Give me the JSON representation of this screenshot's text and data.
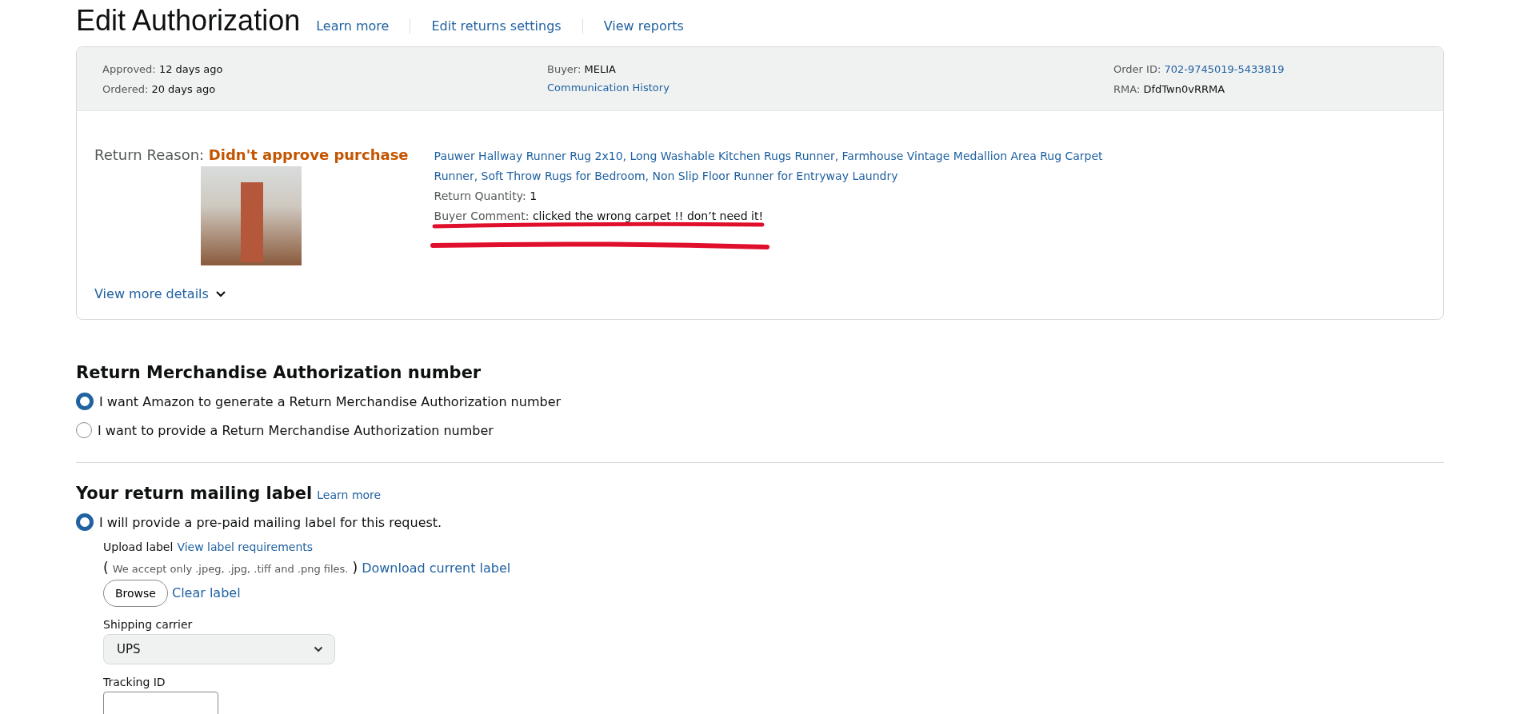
{
  "header": {
    "title": "Edit Authorization",
    "links": [
      "Learn more",
      "Edit returns settings",
      "View reports"
    ]
  },
  "summary": {
    "columns": [
      {
        "rows": [
          {
            "label": "Approved:",
            "value": "12 days ago",
            "kind": "plain"
          },
          {
            "label": "Ordered:",
            "value": "20 days ago",
            "kind": "plain"
          }
        ]
      },
      {
        "rows": [
          {
            "label": "Buyer:",
            "value": "MELIA",
            "kind": "plain"
          },
          {
            "value": "Communication History",
            "kind": "link"
          }
        ]
      },
      {
        "rows": [
          {
            "label": "Order ID:",
            "value": "702-9745019-5433819",
            "kind": "link"
          },
          {
            "label": "RMA:",
            "value": "DfdTwn0vRRMA",
            "kind": "plain"
          }
        ]
      }
    ]
  },
  "item": {
    "reason_label": "Return Reason:",
    "reason": "Didn't approve purchase",
    "product_title": "Pauwer Hallway Runner Rug 2x10, Long Washable Kitchen Rugs Runner, Farmhouse Vintage Medallion Area Rug Carpet Runner, Soft Throw Rugs for Bedroom, Non Slip Floor Runner for Entryway Laundry",
    "quantity_label": "Return Quantity:",
    "quantity": "1",
    "comment_label": "Buyer Comment:",
    "comment": "clicked the wrong carpet !! don’t need it!",
    "details_link": "View more details",
    "expanded": false
  },
  "rma_section": {
    "heading": "Return Merchandise Authorization number",
    "options": [
      {
        "label": "I want Amazon to generate a Return Merchandise Authorization number",
        "selected": true
      },
      {
        "label": "I want to provide a Return Merchandise Authorization number",
        "selected": false
      }
    ]
  },
  "label_section": {
    "heading": "Your return mailing label",
    "link": "Learn more",
    "options": [
      {
        "label": "I will provide a pre-paid mailing label for this request.",
        "selected": true
      }
    ],
    "upload_label": "Upload label",
    "requirements_link": "View label requirements",
    "open_paren": "(",
    "formats": "We accept only .jpeg, .jpg, .tiff and .png files.",
    "close_paren": ")",
    "download_link": "Download current label",
    "browse_button": "Browse",
    "clear_link": "Clear label",
    "carrier_label": "Shipping carrier",
    "carrier": "UPS",
    "tracking_label": "Tracking ID"
  }
}
